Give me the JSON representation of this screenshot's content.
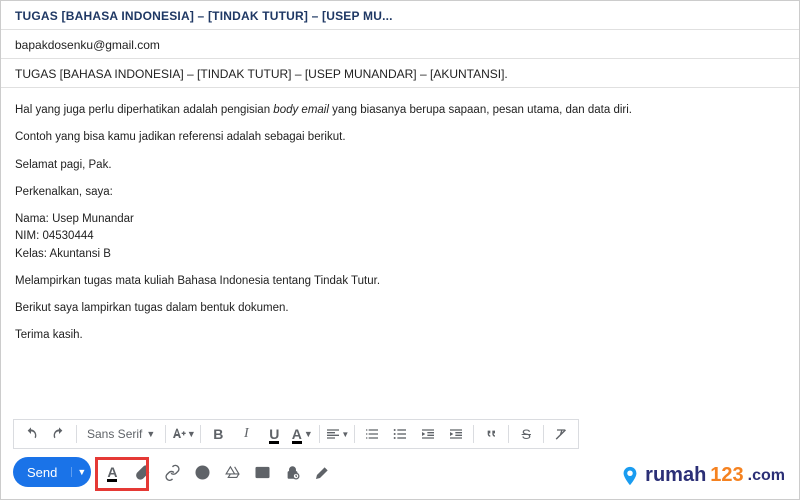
{
  "header": {
    "title": "TUGAS [BAHASA INDONESIA] – [TINDAK TUTUR] – [USEP MU..."
  },
  "recipient": "bapakdosenku@gmail.com",
  "subject": "TUGAS [BAHASA INDONESIA] – [TINDAK TUTUR] – [USEP MUNANDAR]  – [AKUNTANSI].",
  "body": {
    "p1a": "Hal yang juga perlu diperhatikan adalah pengisian ",
    "p1_italic": "body email",
    "p1b": " yang biasanya berupa sapaan, pesan utama, dan data diri.",
    "p2": "Contoh yang bisa kamu jadikan referensi adalah sebagai berikut.",
    "p3": "Selamat pagi, Pak.",
    "p4": "Perkenalkan, saya:",
    "p5": "Nama: Usep Munandar",
    "p6": "NIM: 04530444",
    "p7": "Kelas: Akuntansi B",
    "p8": "Melampirkan tugas mata kuliah Bahasa Indonesia tentang Tindak Tutur.",
    "p9": "Berikut saya lampirkan tugas dalam bentuk dokumen.",
    "p10": "Terima kasih."
  },
  "toolbar": {
    "font_label": "Sans Serif",
    "bold": "B",
    "italic": "I",
    "underline": "U",
    "text_color": "A",
    "strike": "S"
  },
  "footer": {
    "send_label": "Send",
    "text_color": "A"
  },
  "watermark": {
    "brand": "rumah",
    "num": "123",
    "dom": ".com"
  }
}
